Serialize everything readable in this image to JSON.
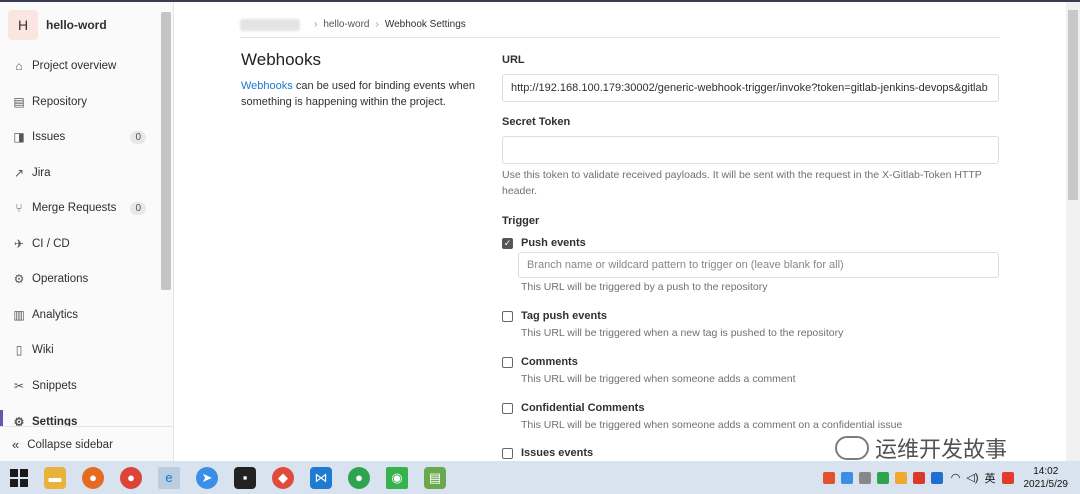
{
  "project": {
    "avatar_letter": "H",
    "name": "hello-word"
  },
  "sidebar": {
    "items": [
      {
        "label": "Project overview",
        "icon": "home-icon",
        "glyph": "⌂",
        "badge": null
      },
      {
        "label": "Repository",
        "icon": "repository-icon",
        "glyph": "▤",
        "badge": null
      },
      {
        "label": "Issues",
        "icon": "issues-icon",
        "glyph": "◨",
        "badge": "0"
      },
      {
        "label": "Jira",
        "icon": "external-link-icon",
        "glyph": "↗",
        "badge": null
      },
      {
        "label": "Merge Requests",
        "icon": "merge-request-icon",
        "glyph": "⑂",
        "badge": "0"
      },
      {
        "label": "CI / CD",
        "icon": "rocket-icon",
        "glyph": "✈",
        "badge": null
      },
      {
        "label": "Operations",
        "icon": "cloud-gear-icon",
        "glyph": "⚙",
        "badge": null
      },
      {
        "label": "Analytics",
        "icon": "chart-icon",
        "glyph": "▥",
        "badge": null
      },
      {
        "label": "Wiki",
        "icon": "book-icon",
        "glyph": "▯",
        "badge": null
      },
      {
        "label": "Snippets",
        "icon": "scissors-icon",
        "glyph": "✂",
        "badge": null
      },
      {
        "label": "Settings",
        "icon": "gear-icon",
        "glyph": "⚙",
        "badge": null
      }
    ],
    "collapse_label": "Collapse sidebar"
  },
  "breadcrumb": {
    "project": "hello-word",
    "current": "Webhook Settings"
  },
  "webhooks": {
    "title": "Webhooks",
    "desc_link": "Webhooks",
    "desc_rest": " can be used for binding events when something is happening within the project."
  },
  "form": {
    "url_label": "URL",
    "url_value": "http://192.168.100.179:30002/generic-webhook-trigger/invoke?token=gitlab-jenkins-devops&gitlab",
    "secret_label": "Secret Token",
    "secret_value": "",
    "secret_help": "Use this token to validate received payloads. It will be sent with the request in the X-Gitlab-Token HTTP header.",
    "trigger_label": "Trigger",
    "push_label": "Push events",
    "push_placeholder": "Branch name or wildcard pattern to trigger on (leave blank for all)",
    "push_help": "This URL will be triggered by a push to the repository",
    "tag_label": "Tag push events",
    "tag_help": "This URL will be triggered when a new tag is pushed to the repository",
    "comments_label": "Comments",
    "comments_help": "This URL will be triggered when someone adds a comment",
    "conf_label": "Confidential Comments",
    "conf_help": "This URL will be triggered when someone adds a comment on a confidential issue",
    "issues_label": "Issues events"
  },
  "watermark": "运维开发故事",
  "taskbar": {
    "tray_lang": "英",
    "time": "14:02",
    "date": "2021/5/29"
  }
}
